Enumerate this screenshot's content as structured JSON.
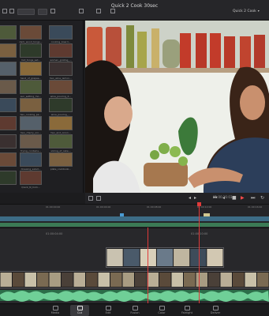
{
  "window": {
    "title": "Quick 2 Cook 30sec",
    "viewer_name": "Quick 2 Cook"
  },
  "media_pool": {
    "clips": [
      {
        "label": ""
      },
      {
        "label": "dark_wood_tongs..."
      },
      {
        "label": "cooking_board..."
      },
      {
        "label": ""
      },
      {
        "label": "mid_tongs_set..."
      },
      {
        "label": "woman_grating_..."
      },
      {
        "label": ""
      },
      {
        "label": "hand_of_grapes..."
      },
      {
        "label": "two_wine_lemon..."
      },
      {
        "label": ""
      },
      {
        "label": "sun_setting_mo..."
      },
      {
        "label": "wine_pouring_2..."
      },
      {
        "label": ""
      },
      {
        "label": "two_cooking_pa..."
      },
      {
        "label": "wine_pouring_..."
      },
      {
        "label": ""
      },
      {
        "label": "two_cherry_oni..."
      },
      {
        "label": "two_and_onion..."
      },
      {
        "label": ""
      },
      {
        "label": "frying_contains..."
      },
      {
        "label": "slicing_of_cake..."
      },
      {
        "label": ""
      },
      {
        "label": "dressing_salad..."
      },
      {
        "label": "plate_cookbook..."
      },
      {
        "label": ""
      },
      {
        "label": "Quick_N_Com..."
      }
    ]
  },
  "timeline": {
    "ruler_labels": [
      "01:00:00:00",
      "01:00:04:00",
      "01:00:08:00",
      "01:00:12:00",
      "01:00:16:00"
    ],
    "lower_ruler_labels": [
      "01:00:04:00",
      "01:00:10:00"
    ],
    "timecode": "01:00:16:03"
  },
  "pages": [
    {
      "label": "Media",
      "icon": "media-icon",
      "active": false
    },
    {
      "label": "Cut",
      "icon": "cut-icon",
      "active": true
    },
    {
      "label": "Edit",
      "icon": "edit-icon",
      "active": false
    },
    {
      "label": "Fusion",
      "icon": "fusion-icon",
      "active": false
    },
    {
      "label": "Color",
      "icon": "color-icon",
      "active": false
    },
    {
      "label": "Fairlight",
      "icon": "fairlight-icon",
      "active": false
    },
    {
      "label": "Deliver",
      "icon": "deliver-icon",
      "active": false
    }
  ],
  "colors": {
    "accent_playhead": "#e03a3a",
    "video_track": "#3d6c86",
    "audio_track": "#2c6e49"
  }
}
